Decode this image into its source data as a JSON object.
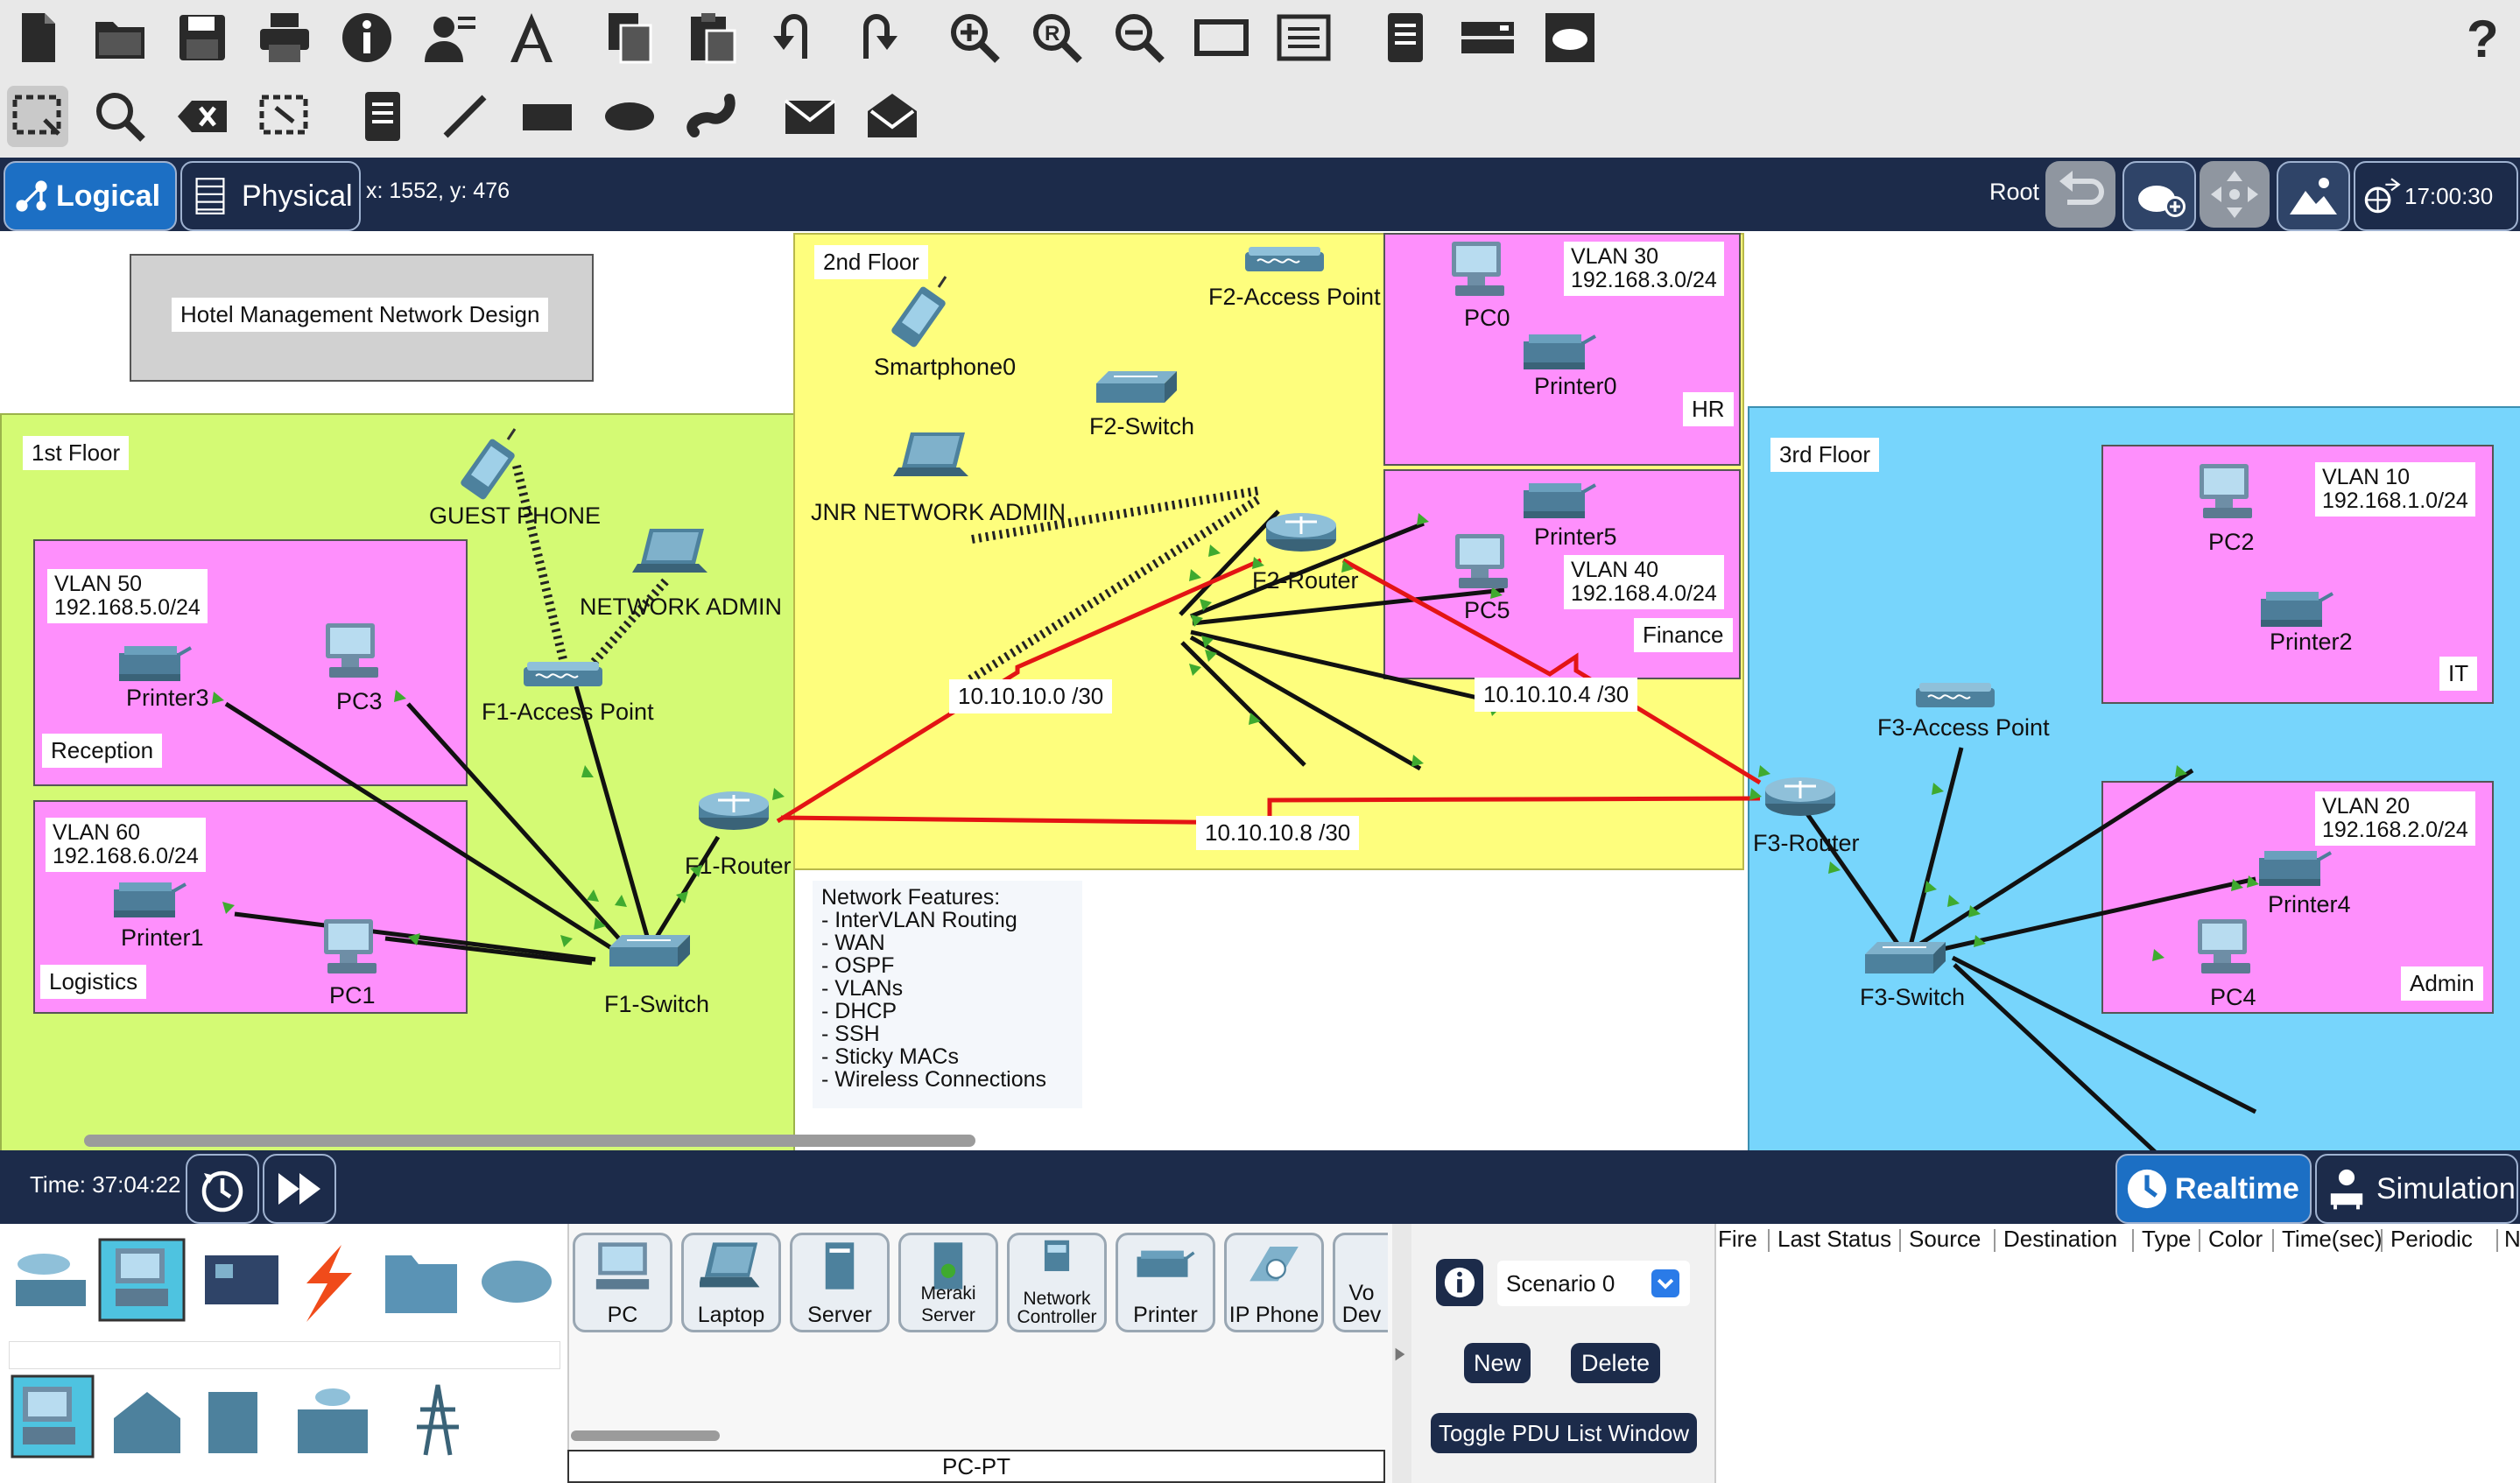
{
  "mode_bar": {
    "logical": "Logical",
    "physical": "Physical",
    "coords": "x: 1552, y: 476",
    "root": "Root",
    "clock": "17:00:30"
  },
  "canvas": {
    "title_box": "Hotel Management Network Design",
    "floors": {
      "first": "1st Floor",
      "second": "2nd Floor",
      "third": "3rd Floor"
    },
    "departments": {
      "reception": "Reception",
      "logistics": "Logistics",
      "hr": "HR",
      "finance": "Finance",
      "it": "IT",
      "admin": "Admin"
    },
    "vlans": {
      "v50": "VLAN 50\n192.168.5.0/24",
      "v60": "VLAN 60\n192.168.6.0/24",
      "v30": "VLAN 30\n192.168.3.0/24",
      "v40": "VLAN 40\n192.168.4.0/24",
      "v10": "VLAN 10\n192.168.1.0/24",
      "v20": "VLAN 20\n192.168.2.0/24"
    },
    "devices": {
      "guest_phone": "GUEST PHONE",
      "network_admin": "NETWORK ADMIN",
      "printer3": "Printer3",
      "pc3": "PC3",
      "f1_ap": "F1-Access Point",
      "printer1": "Printer1",
      "pc1": "PC1",
      "f1_router": "F1-Router",
      "f1_switch": "F1-Switch",
      "smartphone0": "Smartphone0",
      "jnr_admin": "JNR NETWORK ADMIN",
      "f2_ap": "F2-Access Point",
      "f2_switch": "F2-Switch",
      "f2_router": "F2-Router",
      "pc0": "PC0",
      "printer0": "Printer0",
      "printer5": "Printer5",
      "pc5": "PC5",
      "pc2": "PC2",
      "printer2": "Printer2",
      "f3_ap": "F3-Access Point",
      "f3_router": "F3-Router",
      "f3_switch": "F3-Switch",
      "printer4": "Printer4",
      "pc4": "PC4"
    },
    "links": {
      "l1": "10.10.10.0 /30",
      "l2": "10.10.10.4 /30",
      "l3": "10.10.10.8 /30"
    },
    "features": "Network Features:\n- InterVLAN Routing\n- WAN\n- OSPF\n- VLANs\n- DHCP\n- SSH\n- Sticky MACs\n- Wireless Connections"
  },
  "sim_bar": {
    "time": "Time: 37:04:22",
    "realtime": "Realtime",
    "simulation": "Simulation"
  },
  "device_types": [
    "PC",
    "Laptop",
    "Server",
    "Meraki Server",
    "Network Controller",
    "Printer",
    "IP Phone",
    "Vo Dev"
  ],
  "selected_device": "PC-PT",
  "scenario": {
    "name": "Scenario 0",
    "new_btn": "New",
    "delete_btn": "Delete",
    "toggle_btn": "Toggle PDU List Window"
  },
  "pdu_columns": [
    "Fire",
    "Last Status",
    "Source",
    "Destination",
    "Type",
    "Color",
    "Time(sec)",
    "Periodic",
    "N"
  ],
  "colors": {
    "accent": "#1c2b4a",
    "link_red": "#e31414",
    "floor1": "#d4fa74",
    "floor2": "#fefe7d",
    "floor3": "#77d5fc",
    "vlan": "#fe8ffc"
  }
}
